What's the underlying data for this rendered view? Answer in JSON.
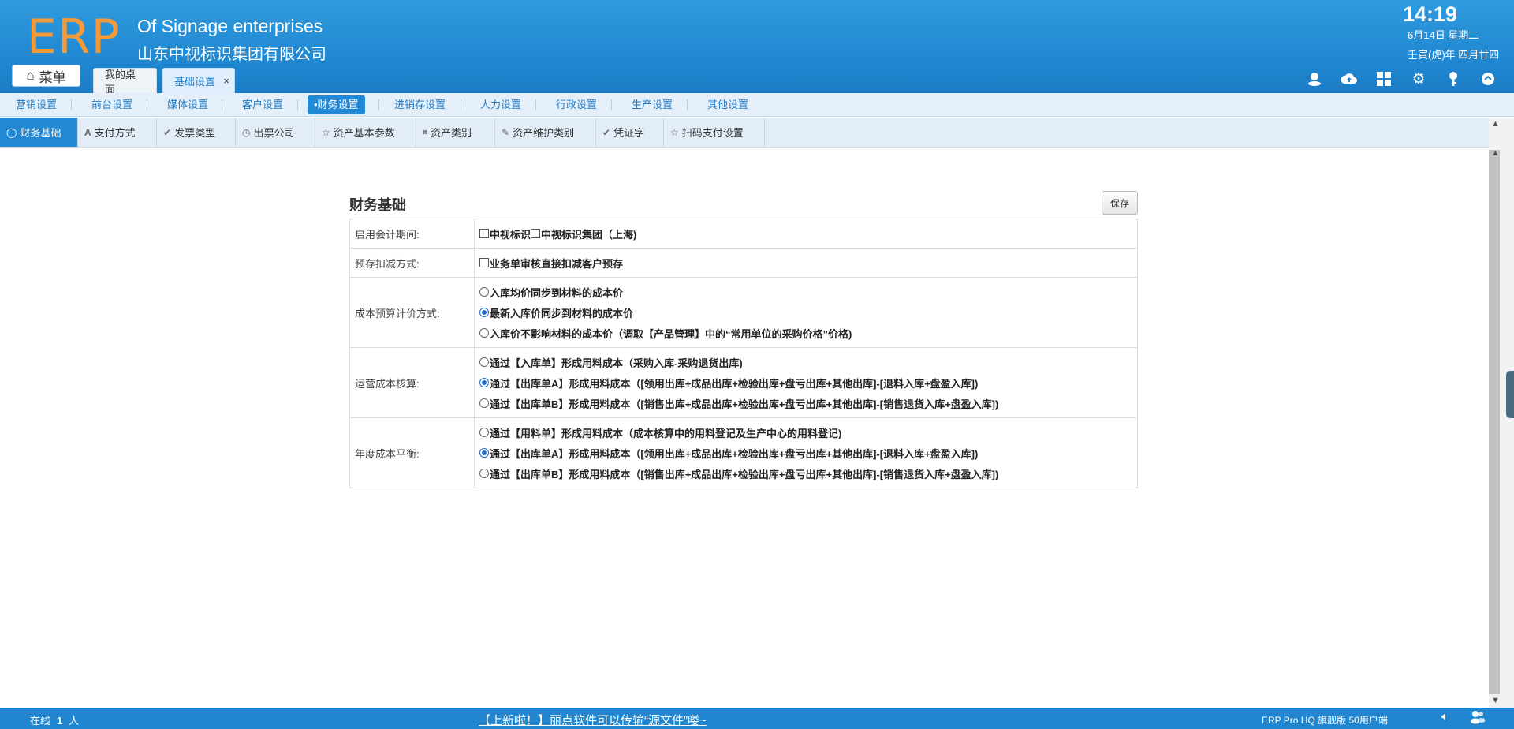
{
  "header": {
    "logo": "ERP",
    "company_en": "Of Signage enterprises",
    "company_cn": "山东中视标识集团有限公司",
    "time": "14:19",
    "date": "6月14日 星期二",
    "lunar": "壬寅(虎)年 四月廿四",
    "menu_label": "菜单",
    "tabs": [
      {
        "label": "我的桌面"
      },
      {
        "label": "基础设置",
        "close": "×"
      }
    ],
    "tool_icons": [
      "user-icon",
      "cloud-upload-icon",
      "apps-icon",
      "gear-icon",
      "key-icon",
      "collapse-icon"
    ]
  },
  "nav1": {
    "items": [
      {
        "label": "营销设置"
      },
      {
        "label": "前台设置"
      },
      {
        "label": "媒体设置"
      },
      {
        "label": "客户设置"
      },
      {
        "label": "•财务设置",
        "active": true
      },
      {
        "label": "进销存设置"
      },
      {
        "label": "人力设置"
      },
      {
        "label": "行政设置"
      },
      {
        "label": "生产设置"
      },
      {
        "label": "其他设置"
      }
    ]
  },
  "nav2": {
    "items": [
      {
        "label": "财务基础",
        "icon": "circle-icon",
        "active": true
      },
      {
        "label": "支付方式",
        "icon": "font-icon"
      },
      {
        "label": "发票类型",
        "icon": "check-icon"
      },
      {
        "label": "出票公司",
        "icon": "clock-icon"
      },
      {
        "label": "资产基本参数",
        "icon": "star-icon"
      },
      {
        "label": "资产类别",
        "icon": "pause-icon"
      },
      {
        "label": "资产维护类别",
        "icon": "pencil-icon"
      },
      {
        "label": "凭证字",
        "icon": "check-icon"
      },
      {
        "label": "扫码支付设置",
        "icon": "star-icon"
      }
    ]
  },
  "panel": {
    "title": "财务基础",
    "save_label": "保存",
    "rows": [
      {
        "label": "启用会计期间:",
        "type": "checkbox-inline",
        "options": [
          {
            "text": "中视标识",
            "checked": false
          },
          {
            "text": "中视标识集团（上海)",
            "checked": false
          }
        ]
      },
      {
        "label": "预存扣减方式:",
        "type": "checkbox",
        "options": [
          {
            "text": "业务单审核直接扣减客户预存",
            "checked": false
          }
        ]
      },
      {
        "label": "成本预算计价方式:",
        "type": "radio",
        "options": [
          {
            "text": "入库均价同步到材料的成本价",
            "checked": false
          },
          {
            "text": "最新入库价同步到材料的成本价",
            "checked": true
          },
          {
            "text": "入库价不影响材料的成本价（调取【产品管理】中的“常用单位的采购价格”价格)",
            "checked": false
          }
        ]
      },
      {
        "label": "运营成本核算:",
        "type": "radio",
        "options": [
          {
            "text": "通过【入库单】形成用料成本（采购入库-采购退货出库)",
            "checked": false
          },
          {
            "text": "通过【出库单A】形成用料成本（[领用出库+成品出库+检验出库+盘亏出库+其他出库]-[退料入库+盘盈入库])",
            "checked": true
          },
          {
            "text": "通过【出库单B】形成用料成本（[销售出库+成品出库+检验出库+盘亏出库+其他出库]-[销售退货入库+盘盈入库])",
            "checked": false
          }
        ]
      },
      {
        "label": "年度成本平衡:",
        "type": "radio",
        "options": [
          {
            "text": "通过【用料单】形成用料成本（成本核算中的用料登记及生产中心的用料登记)",
            "checked": false
          },
          {
            "text": "通过【出库单A】形成用料成本（[领用出库+成品出库+检验出库+盘亏出库+其他出库]-[退料入库+盘盈入库])",
            "checked": true
          },
          {
            "text": "通过【出库单B】形成用料成本（[销售出库+成品出库+检验出库+盘亏出库+其他出库]-[销售退货入库+盘盈入库])",
            "checked": false
          }
        ]
      }
    ]
  },
  "footer": {
    "online_label": "在线",
    "online_count": "1",
    "online_unit": "人",
    "notice": "【上新啦！】丽点软件可以传输“源文件”喽~",
    "version": "ERP Pro HQ 旗舰版 50用户端",
    "icons": [
      "volume-icon",
      "users-icon"
    ]
  },
  "colors": {
    "header_blue": "#1f86cf",
    "accent_blue": "#2388d3",
    "logo_orange": "#f39a3a"
  }
}
